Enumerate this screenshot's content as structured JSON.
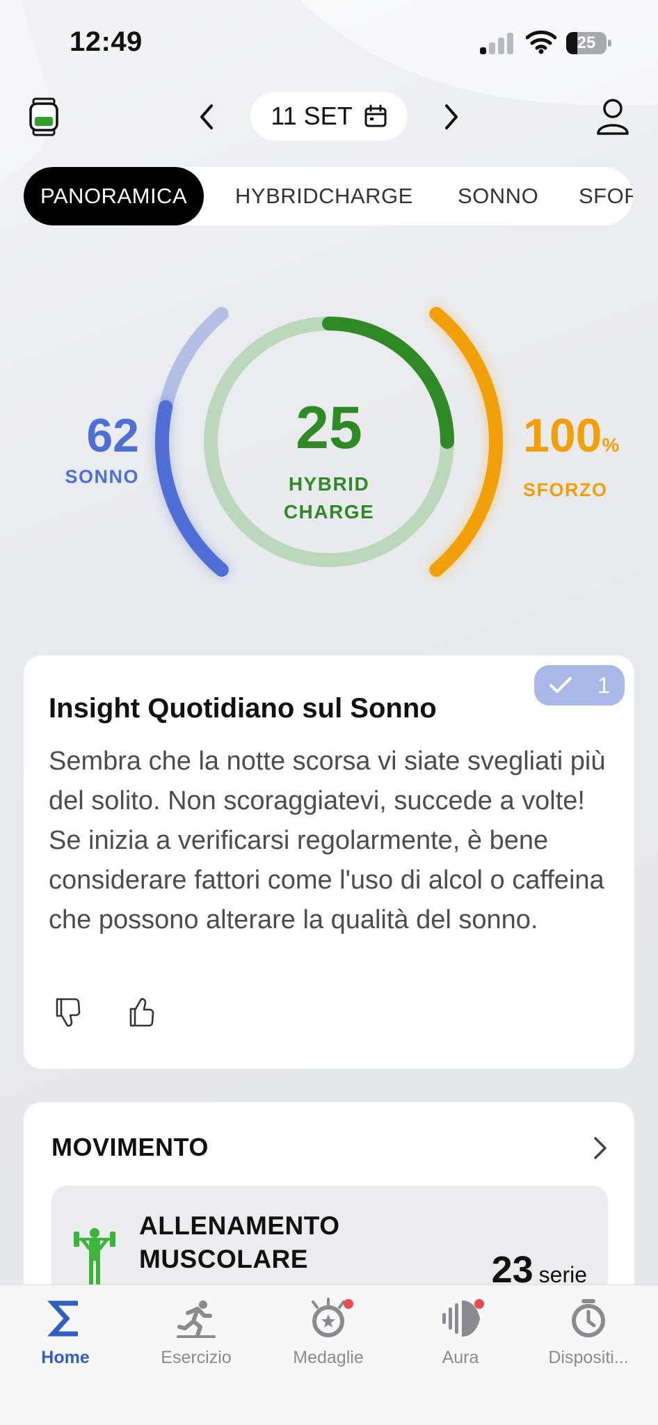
{
  "status_bar": {
    "time": "12:49",
    "battery": "25"
  },
  "header": {
    "date": "11 SET"
  },
  "tabs": [
    {
      "label": "PANORAMICA",
      "active": true
    },
    {
      "label": "HYBRIDCHARGE",
      "active": false
    },
    {
      "label": "SONNO",
      "active": false
    },
    {
      "label": "SFORZO",
      "active": false
    }
  ],
  "scores": {
    "sleep": {
      "value": "62",
      "label": "SONNO",
      "level": 0.62,
      "color": "#4f6fd6"
    },
    "hybrid": {
      "value": "25",
      "label_line1": "HYBRID",
      "label_line2": "CHARGE",
      "level": 0.25,
      "color": "#2f8a26"
    },
    "effort": {
      "value": "100",
      "unit": "%",
      "label": "SFORZO",
      "level": 1.0,
      "color": "#f2a007"
    }
  },
  "insight": {
    "title": "Insight Quotidiano sul Sonno",
    "body": "Sembra che la notte scorsa vi siate svegliati più del solito. Non scoraggiatevi, succede a volte! Se inizia a verificarsi regolarmente, è bene considerare fattori come l'uso di alcol o caffeina che possono alterare la qualità del sonno.",
    "badge_count": "1"
  },
  "movement": {
    "title": "MOVIMENTO",
    "activity": {
      "title_line1": "ALLENAMENTO",
      "title_line2": "MUSCOLARE",
      "value": "23",
      "unit": "serie"
    }
  },
  "nav": [
    {
      "label": "Home",
      "icon": "sigma-icon",
      "active": true,
      "badge": false
    },
    {
      "label": "Esercizio",
      "icon": "runner-icon",
      "active": false,
      "badge": false
    },
    {
      "label": "Medaglie",
      "icon": "medal-icon",
      "active": false,
      "badge": true
    },
    {
      "label": "Aura",
      "icon": "aura-icon",
      "active": false,
      "badge": true
    },
    {
      "label": "Dispositi...",
      "icon": "stopwatch-icon",
      "active": false,
      "badge": false
    }
  ]
}
